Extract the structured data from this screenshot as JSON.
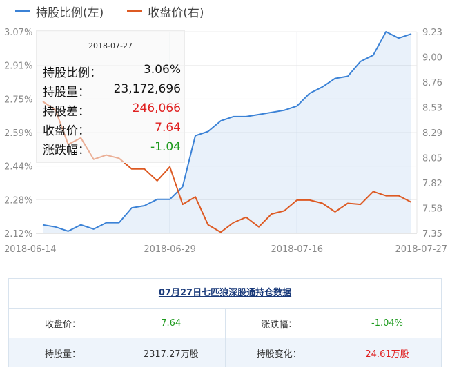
{
  "legend": [
    {
      "name": "持股比例(左)",
      "color": "#3b82d6"
    },
    {
      "name": "收盘价(右)",
      "color": "#dd5a23"
    }
  ],
  "tooltip": {
    "date": "2018-07-27",
    "rows": [
      {
        "label": "持股比例：",
        "value": "3.06%",
        "tone": "normal"
      },
      {
        "label": "持股量：",
        "value": "23,172,696",
        "tone": "normal"
      },
      {
        "label": "持股差：",
        "value": "246,066",
        "tone": "red"
      },
      {
        "label": "收盘价：",
        "value": "7.64",
        "tone": "red"
      },
      {
        "label": "涨跌幅：",
        "value": "-1.04",
        "tone": "green"
      }
    ]
  },
  "chart_data": {
    "type": "line",
    "x_tick_labels": [
      "2018-06-14",
      "2018-06-29",
      "2018-07-16",
      "2018-07-27"
    ],
    "x_tick_index": [
      0,
      10,
      20,
      29
    ],
    "x_gridline_index": [
      10,
      20
    ],
    "y_left": {
      "ticks": [
        "2.12%",
        "2.28%",
        "2.44%",
        "2.59%",
        "2.75%",
        "2.91%",
        "3.07%"
      ],
      "range": [
        2.12,
        3.07
      ]
    },
    "y_right": {
      "ticks": [
        "7.35",
        "7.58",
        "7.82",
        "8.05",
        "8.29",
        "8.53",
        "8.76",
        "9.00",
        "9.23"
      ],
      "range": [
        7.35,
        9.23
      ]
    },
    "grid": true,
    "series": [
      {
        "name": "持股比例(左)",
        "axis": "left",
        "color": "#3b82d6",
        "area": true,
        "values": [
          2.16,
          2.15,
          2.13,
          2.16,
          2.14,
          2.17,
          2.17,
          2.24,
          2.25,
          2.28,
          2.28,
          2.34,
          2.58,
          2.6,
          2.65,
          2.67,
          2.67,
          2.68,
          2.69,
          2.7,
          2.72,
          2.78,
          2.81,
          2.85,
          2.86,
          2.93,
          2.96,
          3.07,
          3.04,
          3.06
        ]
      },
      {
        "name": "收盘价(右)",
        "axis": "right",
        "color": "#dd5a23",
        "area": false,
        "values": [
          8.58,
          8.5,
          8.18,
          8.24,
          8.04,
          8.08,
          8.05,
          7.95,
          7.95,
          7.84,
          7.97,
          7.62,
          7.69,
          7.43,
          7.36,
          7.45,
          7.5,
          7.41,
          7.53,
          7.56,
          7.66,
          7.66,
          7.63,
          7.55,
          7.63,
          7.62,
          7.74,
          7.7,
          7.7,
          7.64
        ]
      }
    ]
  },
  "table": {
    "title": "07月27日七匹狼深股通持仓数据",
    "rows": [
      [
        {
          "text": "收盘价：",
          "tone": "normal"
        },
        {
          "text": "7.64",
          "tone": "green"
        },
        {
          "text": "涨跌幅：",
          "tone": "normal"
        },
        {
          "text": "-1.04%",
          "tone": "green"
        }
      ],
      [
        {
          "text": "持股量：",
          "tone": "normal"
        },
        {
          "text": "2317.27万股",
          "tone": "normal"
        },
        {
          "text": "持股变化：",
          "tone": "normal"
        },
        {
          "text": "24.61万股",
          "tone": "red"
        }
      ]
    ]
  }
}
